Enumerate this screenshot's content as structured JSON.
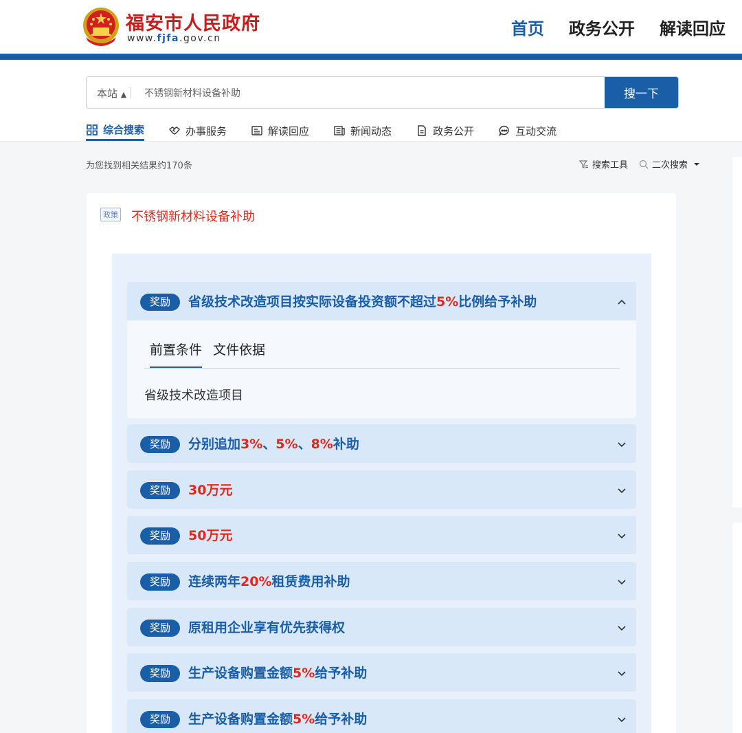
{
  "header": {
    "site_name": "福安市人民政府",
    "domain_prefix": "www.",
    "domain_highlight": "fjfa",
    "domain_suffix": ".gov.cn",
    "nav": [
      "首页",
      "政务公开",
      "解读回应"
    ],
    "brand_color": "#1a5ea8",
    "title_color": "#c81d1d"
  },
  "search": {
    "scope": "本站",
    "query": "不锈钢新材料设备补助",
    "button": "搜一下"
  },
  "tabs": [
    {
      "label": "综合搜索",
      "icon": "grid-icon"
    },
    {
      "label": "办事服务",
      "icon": "handshake-icon"
    },
    {
      "label": "解读回应",
      "icon": "id-card-icon"
    },
    {
      "label": "新闻动态",
      "icon": "newspaper-icon"
    },
    {
      "label": "政务公开",
      "icon": "document-icon"
    },
    {
      "label": "互动交流",
      "icon": "chat-icon"
    }
  ],
  "results": {
    "count_text": "为您找到相关结果约170条",
    "tool_filter": "搜索工具",
    "tool_secondary": "二次搜索"
  },
  "card": {
    "tag": "政策",
    "title": "不锈钢新材料设备补助",
    "badge": "奖励",
    "expanded": {
      "title_parts": [
        "省级技术改造项目按实际设备投资额不超过",
        "5%",
        "比例给予补助"
      ],
      "subtabs": [
        "前置条件",
        "文件依据"
      ],
      "content": "省级技术改造项目"
    },
    "items": [
      {
        "parts": [
          "分别追加",
          "3%",
          "、",
          "5%",
          "、",
          "8%",
          "补助"
        ]
      },
      {
        "parts": [
          "",
          "30万元"
        ]
      },
      {
        "parts": [
          "",
          "50万元"
        ]
      },
      {
        "parts": [
          "连续两年",
          "20%",
          "租赁费用补助"
        ]
      },
      {
        "parts": [
          "原租用企业享有优先获得权"
        ]
      },
      {
        "parts": [
          "生产设备购置金额",
          "5%",
          "给予补助"
        ]
      },
      {
        "parts": [
          "生产设备购置金额",
          "5%",
          "给予补助"
        ]
      }
    ]
  }
}
